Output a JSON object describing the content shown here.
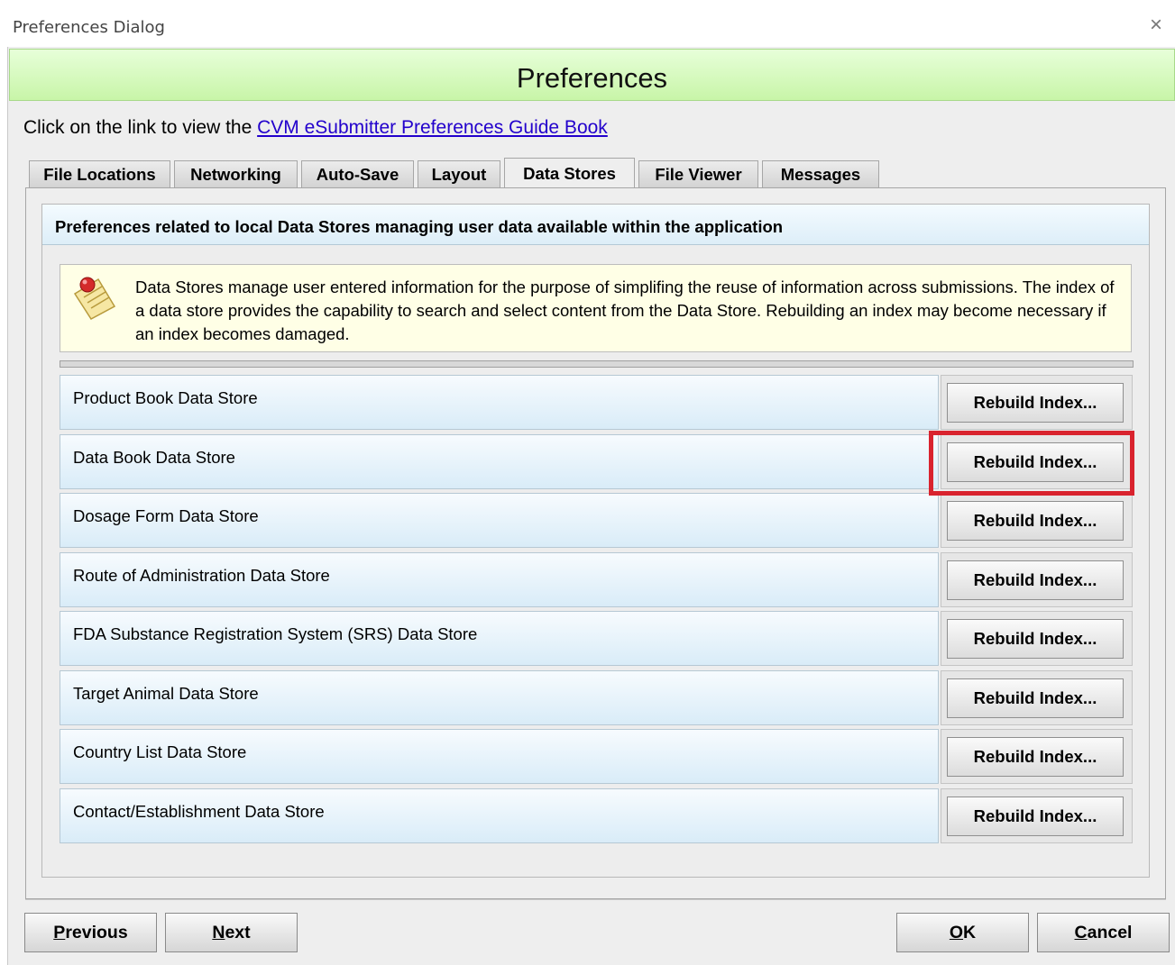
{
  "window": {
    "title": "Preferences Dialog",
    "close_glyph": "×"
  },
  "banner": {
    "title": "Preferences"
  },
  "intro": {
    "text": "Click on the link to view the ",
    "link": "CVM eSubmitter Preferences Guide Book"
  },
  "tabs": [
    {
      "label": "File Locations",
      "active": false
    },
    {
      "label": "Networking",
      "active": false
    },
    {
      "label": "Auto-Save",
      "active": false
    },
    {
      "label": "Layout",
      "active": false
    },
    {
      "label": "Data Stores",
      "active": true
    },
    {
      "label": "File Viewer",
      "active": false
    },
    {
      "label": "Messages",
      "active": false
    }
  ],
  "panel": {
    "header": "Preferences related to local Data Stores managing user data available within the application",
    "note_icon": "notepad-pin-icon",
    "note": "Data Stores manage user entered information for the purpose of simplifing the reuse of information across submissions. The index of a data store provides the capability to search and select content from the Data Store. Rebuilding an index may become necessary if an index becomes damaged."
  },
  "data_stores": [
    {
      "name": "Product Book Data Store",
      "button": "Rebuild Index..."
    },
    {
      "name": "Data Book Data Store",
      "button": "Rebuild Index...",
      "highlighted": true
    },
    {
      "name": "Dosage Form Data Store",
      "button": "Rebuild Index..."
    },
    {
      "name": "Route of Administration Data Store",
      "button": "Rebuild Index..."
    },
    {
      "name": "FDA Substance Registration System (SRS) Data Store",
      "button": "Rebuild Index..."
    },
    {
      "name": "Target Animal Data Store",
      "button": "Rebuild Index..."
    },
    {
      "name": "Country List Data Store",
      "button": "Rebuild Index..."
    },
    {
      "name": "Contact/Establishment Data Store",
      "button": "Rebuild Index..."
    }
  ],
  "footer": {
    "previous_mnemonic": "P",
    "previous_rest": "revious",
    "next_mnemonic": "N",
    "next_rest": "ext",
    "ok_mnemonic": "O",
    "ok_rest": "K",
    "cancel_mnemonic": "C",
    "cancel_rest": "ancel"
  },
  "colors": {
    "banner": "#c8f5a8",
    "highlight": "#d9232e",
    "link": "#2200cc",
    "note_bg": "#ffffe6"
  }
}
